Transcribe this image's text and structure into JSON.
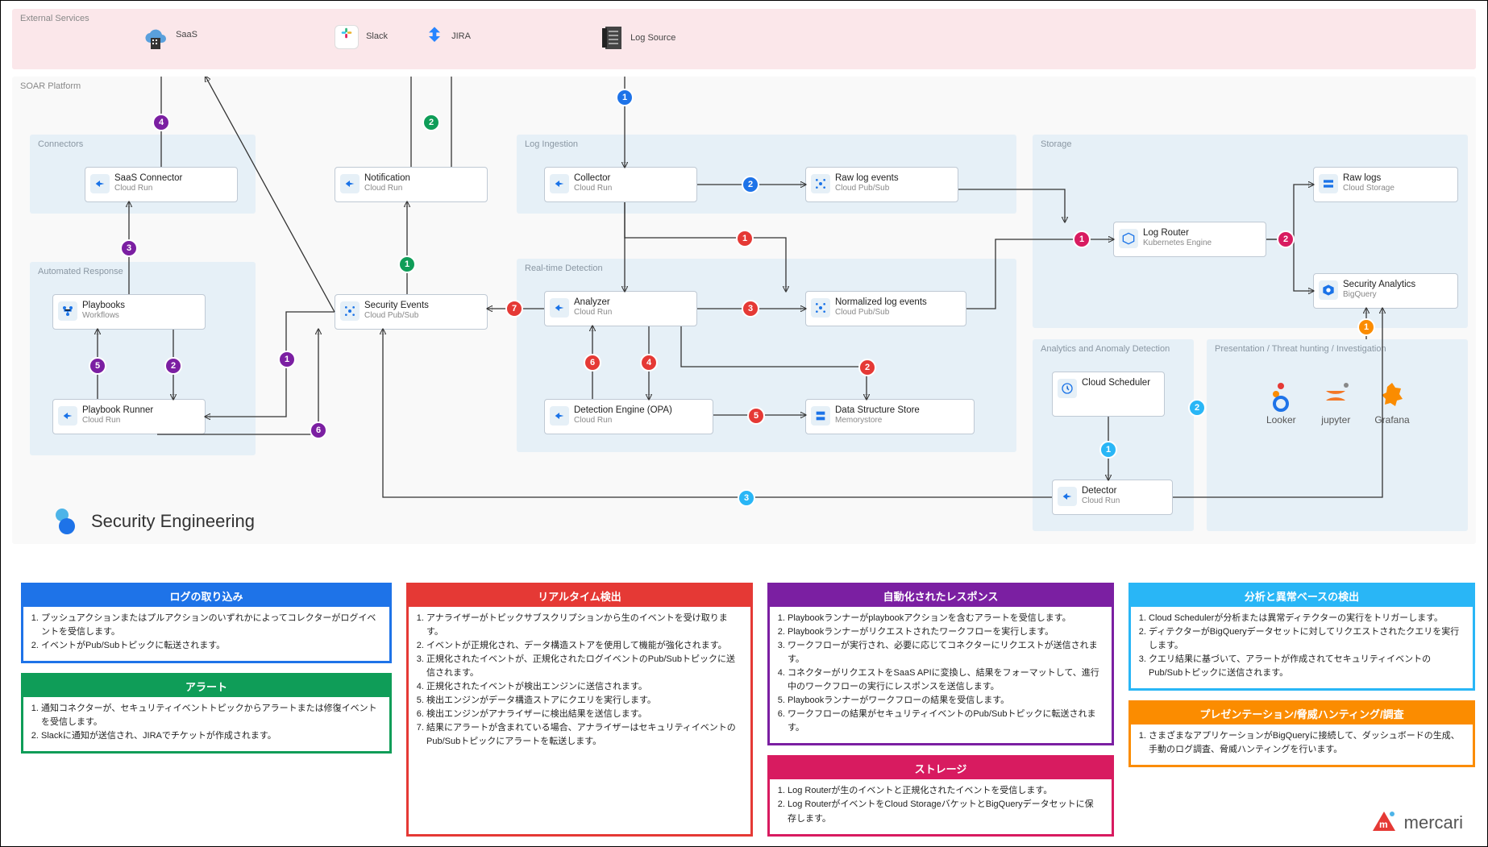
{
  "zones": {
    "external": "External Services",
    "soar": "SOAR Platform",
    "connectors": "Connectors",
    "automated": "Automated Response",
    "ingestion": "Log Ingestion",
    "realtime": "Real-time Detection",
    "analytics": "Analytics and Anomaly Detection",
    "storage": "Storage",
    "presentation": "Presentation / Threat hunting / Investigation"
  },
  "ext": {
    "saas": "SaaS",
    "slack": "Slack",
    "jira": "JIRA",
    "logsource": "Log Source"
  },
  "nodes": {
    "saas_connector": {
      "t": "SaaS Connector",
      "s": "Cloud Run"
    },
    "notification": {
      "t": "Notification",
      "s": "Cloud Run"
    },
    "playbooks": {
      "t": "Playbooks",
      "s": "Workflows"
    },
    "playbook_runner": {
      "t": "Playbook Runner",
      "s": "Cloud Run"
    },
    "security_events": {
      "t": "Security Events",
      "s": "Cloud Pub/Sub"
    },
    "collector": {
      "t": "Collector",
      "s": "Cloud Run"
    },
    "raw_log_events": {
      "t": "Raw log events",
      "s": "Cloud Pub/Sub"
    },
    "analyzer": {
      "t": "Analyzer",
      "s": "Cloud Run"
    },
    "normalized": {
      "t": "Normalized log events",
      "s": "Cloud Pub/Sub"
    },
    "detection": {
      "t": "Detection Engine (OPA)",
      "s": "Cloud Run"
    },
    "dss": {
      "t": "Data Structure Store",
      "s": "Memorystore"
    },
    "scheduler": {
      "t": "Cloud Scheduler",
      "s": ""
    },
    "detector": {
      "t": "Detector",
      "s": "Cloud Run"
    },
    "log_router": {
      "t": "Log Router",
      "s": "Kubernetes Engine"
    },
    "raw_logs": {
      "t": "Raw logs",
      "s": "Cloud Storage"
    },
    "bigquery": {
      "t": "Security Analytics",
      "s": "BigQuery"
    }
  },
  "presentation_tools": {
    "looker": "Looker",
    "jupyter": "jupyter",
    "grafana": "Grafana"
  },
  "branding": {
    "sec_eng": "Security Engineering",
    "mercari": "mercari"
  },
  "legend": {
    "ingest": {
      "title": "ログの取り込み",
      "color": "#1e73e8",
      "items": [
        "プッシュアクションまたはプルアクションのいずれかによってコレクターがログイベントを受信します。",
        "イベントがPub/Subトピックに転送されます。"
      ]
    },
    "alert": {
      "title": "アラート",
      "color": "#0f9d58",
      "items": [
        "通知コネクターが、セキュリティイベントトピックからアラートまたは修復イベントを受信します。",
        "Slackに通知が送信され、JIRAでチケットが作成されます。"
      ]
    },
    "realtime": {
      "title": "リアルタイム検出",
      "color": "#e53935",
      "items": [
        "アナライザーがトピックサブスクリプションから生のイベントを受け取ります。",
        "イベントが正規化され、データ構造ストアを使用して機能が強化されます。",
        "正規化されたイベントが、正規化されたログイベントのPub/Subトピックに送信されます。",
        "正規化されたイベントが検出エンジンに送信されます。",
        "検出エンジンがデータ構造ストアにクエリを実行します。",
        "検出エンジンがアナライザーに検出結果を送信します。",
        "結果にアラートが含まれている場合、アナライザーはセキュリティイベントのPub/Subトピックにアラートを転送します。"
      ]
    },
    "auto": {
      "title": "自動化されたレスポンス",
      "color": "#7b1fa2",
      "items": [
        "Playbookランナーがplaybookアクションを含むアラートを受信します。",
        "Playbookランナーがリクエストされたワークフローを実行します。",
        "ワークフローが実行され、必要に応じてコネクターにリクエストが送信されます。",
        "コネクターがリクエストをSaaS APIに変換し、結果をフォーマットして、進行中のワークフローの実行にレスポンスを送信します。",
        "Playbookランナーがワークフローの結果を受信します。",
        "ワークフローの結果がセキュリティイベントのPub/Subトピックに転送されます。"
      ]
    },
    "storage": {
      "title": "ストレージ",
      "color": "#d81b60",
      "items": [
        "Log Routerが生のイベントと正規化されたイベントを受信します。",
        "Log RouterがイベントをCloud StorageバケットとBigQueryデータセットに保存します。"
      ]
    },
    "analytics": {
      "title": "分析と異常ベースの検出",
      "color": "#29b6f6",
      "items": [
        "Cloud Schedulerが分析または異常ディテクターの実行をトリガーします。",
        "ディテクターがBigQueryデータセットに対してリクエストされたクエリを実行します。",
        "クエリ結果に基づいて、アラートが作成されてセキュリティイベントのPub/Subトピックに送信されます。"
      ]
    },
    "present": {
      "title": "プレゼンテーション/脅威ハンティング/調査",
      "color": "#fb8c00",
      "items": [
        "さまざまなアプリケーションがBigQueryに接続して、ダッシュボードの生成、手動のログ調査、脅威ハンティングを行います。"
      ]
    }
  }
}
